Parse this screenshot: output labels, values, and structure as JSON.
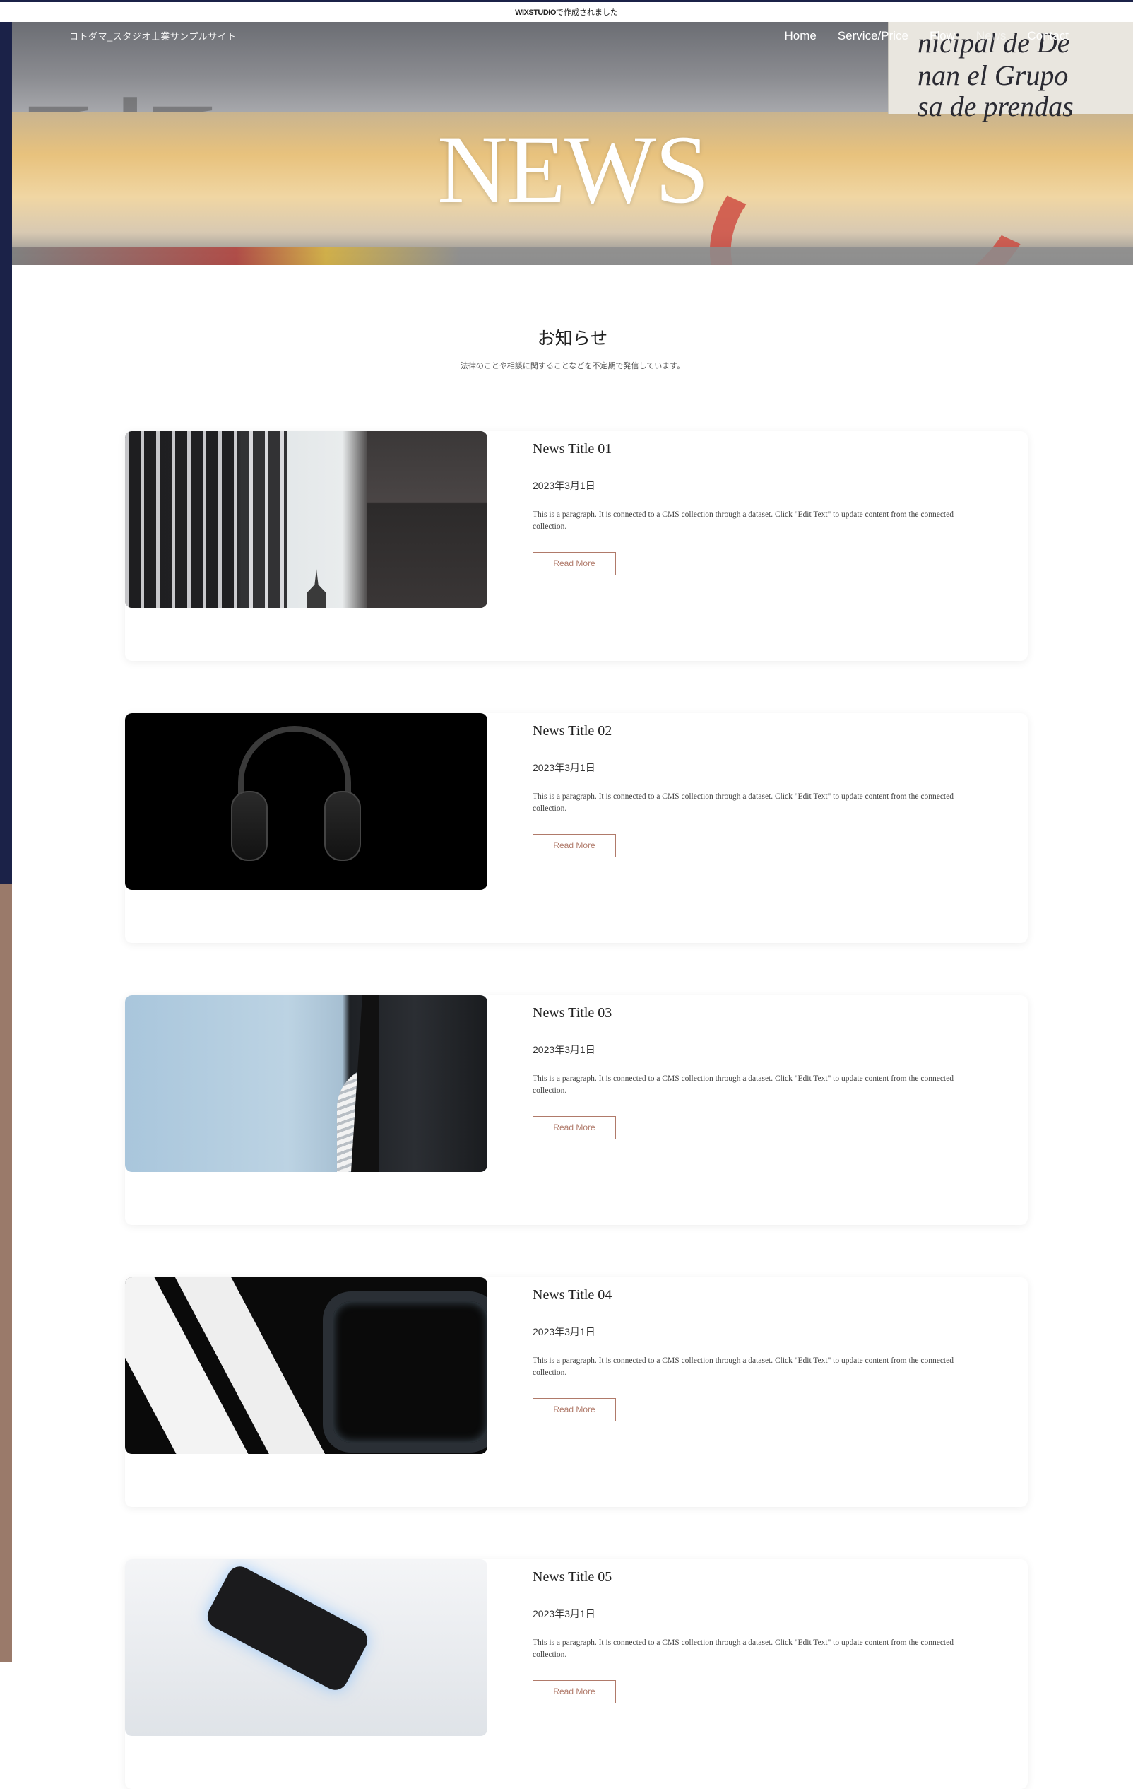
{
  "top_banner": {
    "brand": "WIXSTUDIO",
    "text": "で作成されました"
  },
  "header": {
    "site_name": "コトダマ_スタジオ士業サンプルサイト",
    "nav": [
      {
        "label": "Home"
      },
      {
        "label": "Service/Price"
      },
      {
        "label": "Flow"
      },
      {
        "label": "News"
      },
      {
        "label": "Contact"
      }
    ]
  },
  "hero": {
    "title": "NEWS",
    "paper_lines": [
      "nicipal de De",
      "nan el Grupo",
      "sa de prendas"
    ]
  },
  "intro": {
    "title": "お知らせ",
    "subtitle": "法律のことや相談に関することなどを不定期で発信しています。"
  },
  "news": [
    {
      "title": "News Title 01",
      "date": "2023年3月1日",
      "description": "This is a paragraph. It is connected to a CMS collection through a dataset. Click \"Edit Text\" to update content from the connected collection.",
      "button": "Read More"
    },
    {
      "title": "News Title 02",
      "date": "2023年3月1日",
      "description": "This is a paragraph. It is connected to a CMS collection through a dataset. Click \"Edit Text\" to update content from the connected collection.",
      "button": "Read More"
    },
    {
      "title": "News Title 03",
      "date": "2023年3月1日",
      "description": "This is a paragraph. It is connected to a CMS collection through a dataset. Click \"Edit Text\" to update content from the connected collection.",
      "button": "Read More"
    },
    {
      "title": "News Title 04",
      "date": "2023年3月1日",
      "description": "This is a paragraph. It is connected to a CMS collection through a dataset. Click \"Edit Text\" to update content from the connected collection.",
      "button": "Read More"
    },
    {
      "title": "News Title 05",
      "date": "2023年3月1日",
      "description": "This is a paragraph. It is connected to a CMS collection through a dataset. Click \"Edit Text\" to update content from the connected collection.",
      "button": "Read More"
    }
  ]
}
